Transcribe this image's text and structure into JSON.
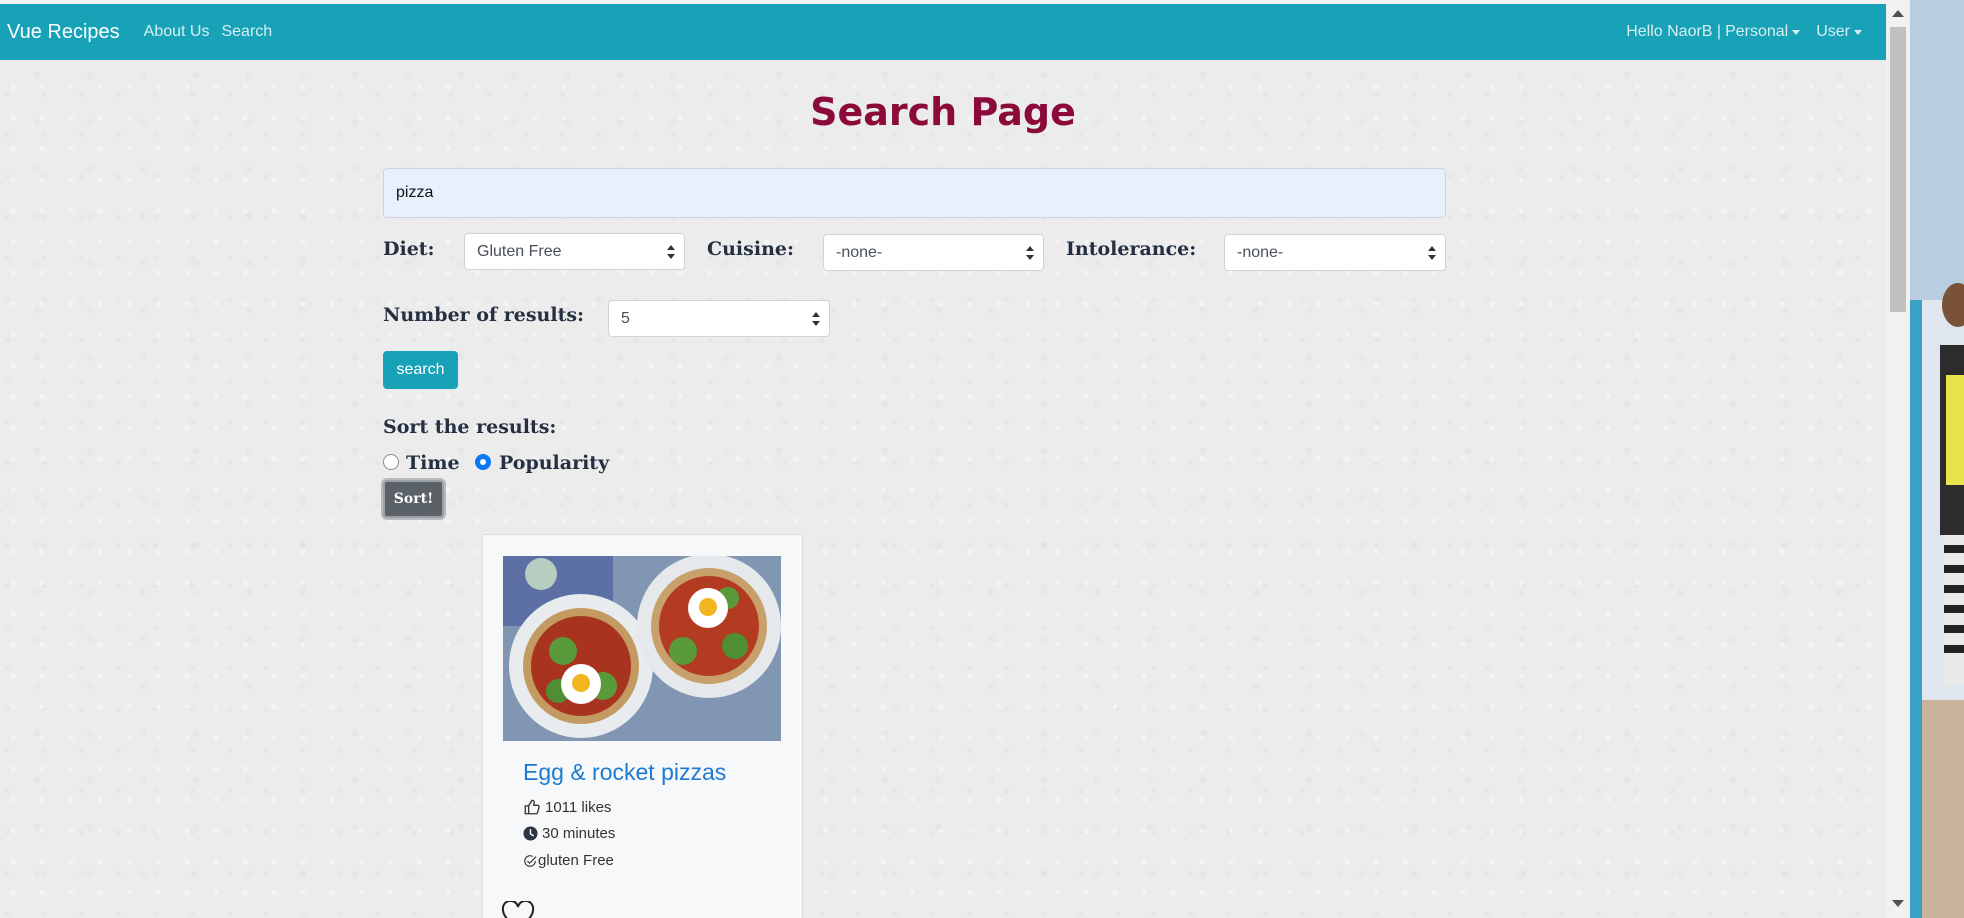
{
  "navbar": {
    "brand": "Vue Recipes",
    "links": [
      "About Us",
      "Search"
    ],
    "greeting": "Hello NaorB |",
    "personal_label": "Personal",
    "user_label": "User"
  },
  "page": {
    "title": "Search Page"
  },
  "search": {
    "value": "pizza"
  },
  "filters": {
    "diet_label": "Diet:",
    "diet_value": "Gluten Free",
    "cuisine_label": "Cuisine:",
    "cuisine_value": "-none-",
    "intolerance_label": "Intolerance:",
    "intolerance_value": "-none-",
    "results_label": "Number of results:",
    "results_value": "5"
  },
  "search_button": "search",
  "sort": {
    "label": "Sort the results:",
    "options": [
      {
        "label": "Time",
        "selected": false
      },
      {
        "label": "Popularity",
        "selected": true
      }
    ],
    "button": "Sort!"
  },
  "results": [
    {
      "title": "Egg & rocket pizzas",
      "likes": "1011 likes",
      "time": "30 minutes",
      "diet": "gluten Free",
      "image_icon": "pizza-photo"
    }
  ],
  "colors": {
    "navbar": "#17a2b8",
    "title": "#8b0a3a",
    "link": "#1e7ad1",
    "radio_selected": "#0b78f5"
  }
}
